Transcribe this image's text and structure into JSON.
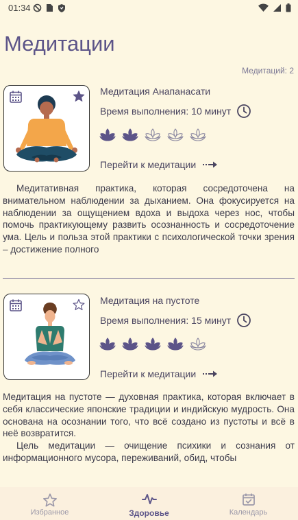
{
  "status": {
    "time": "01:34"
  },
  "page": {
    "title": "Медитации",
    "count_label": "Медитаций: 2"
  },
  "meditations": [
    {
      "title": "Медитация Анапанасати",
      "time_label": "Время выполнения: 10 минут",
      "difficulty": 2,
      "difficulty_max": 5,
      "favorite": true,
      "goto_label": "Перейти к медитации",
      "description": [
        "Медитативная практика, которая сосредоточена на внимательном наблюдении за дыханием. Она фокусируется на наблюдении за ощущением вдоха и выдоха через нос, чтобы помочь практикующему развить осознанность и сосредоточение ума. Цель и польза этой практики с психологической точки зрения – достижение полного"
      ]
    },
    {
      "title": "Медитация на пустоте",
      "time_label": "Время выполнения: 15 минут",
      "difficulty": 4,
      "difficulty_max": 5,
      "favorite": false,
      "goto_label": "Перейти к медитации",
      "description": [
        "Медитация на пустоте — духовная практика, которая включает в себя классические японские традиции и индийскую мудрость. Она основана на осознании того, что всё создано из пустоты и всё в неё возвратится.",
        "Цель медитации — очищение психики и сознания от информационного мусора, переживаний, обид, чтобы"
      ]
    }
  ],
  "nav": [
    {
      "label": "Избранное",
      "icon": "star-icon",
      "active": false
    },
    {
      "label": "Здоровье",
      "icon": "pulse-icon",
      "active": true
    },
    {
      "label": "Календарь",
      "icon": "calendar-check-icon",
      "active": false
    }
  ],
  "colors": {
    "accent": "#5c5488",
    "background": "#fdf7e2",
    "nav_bg": "#fbf0de"
  }
}
